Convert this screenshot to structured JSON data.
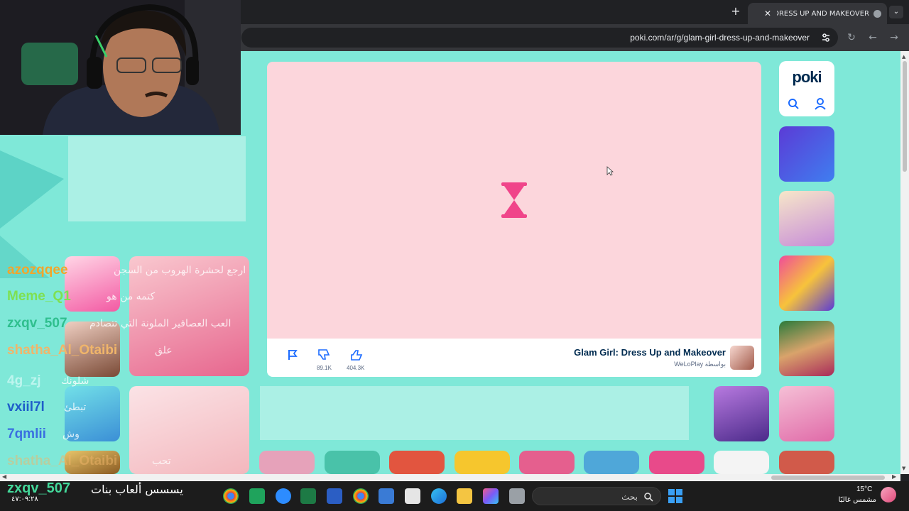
{
  "browser": {
    "tab_title": "GLAM GIRL: DRESS UP AND MAKEOVER",
    "tab_close": "✕",
    "new_tab": "+",
    "tab_search": "⌄",
    "url": "poki.com/ar/g/glam-girl-dress-up-and-makeover",
    "reload": "↻",
    "back": "←",
    "forward": "→"
  },
  "game": {
    "title": "Glam Girl: Dress Up and Makeover",
    "developer": "WeLoPlay بواسطة",
    "dislikes": "89.1K",
    "likes": "404.3K"
  },
  "poki": {
    "logo": "poki"
  },
  "chat": [
    {
      "user": "azozqqee",
      "color": "#f2a52b",
      "message": "ارجع لحشرة الهروب من السجن"
    },
    {
      "user": "Meme_Q1",
      "color": "#7ee052",
      "message": "كتمه من هو"
    },
    {
      "user": "zxqv_507",
      "color": "#2fbf8e",
      "message": "العب العصافير الملونة التي تتصادم"
    },
    {
      "user": "shatha_Al_Otaibi",
      "color": "#f0b56a",
      "message": "علق"
    },
    {
      "user": "4g_zj",
      "color": "#bdf5ee",
      "message": "شلونك"
    },
    {
      "user": "vxiil7l",
      "color": "#1f5ec9",
      "message": "تبطئ"
    },
    {
      "user": "7qmlii",
      "color": "#3a6fe0",
      "message": "وش"
    },
    {
      "user": "shatha_Al_Otaibi",
      "color": "#f0b56a",
      "message": "تحب"
    }
  ],
  "bottom_chat": {
    "user": "zxqv_507",
    "message": "يسسس ألعاب بنات",
    "time": "٤٧:٠٩:٢٨"
  },
  "taskbar": {
    "search_placeholder": "بحث",
    "temperature": "15°C",
    "weather": "مشمس غالبًا"
  },
  "colors": {
    "page_bg": "#7fe8d8",
    "game_bg": "#fcd6dc",
    "accent": "#1b6bff"
  }
}
